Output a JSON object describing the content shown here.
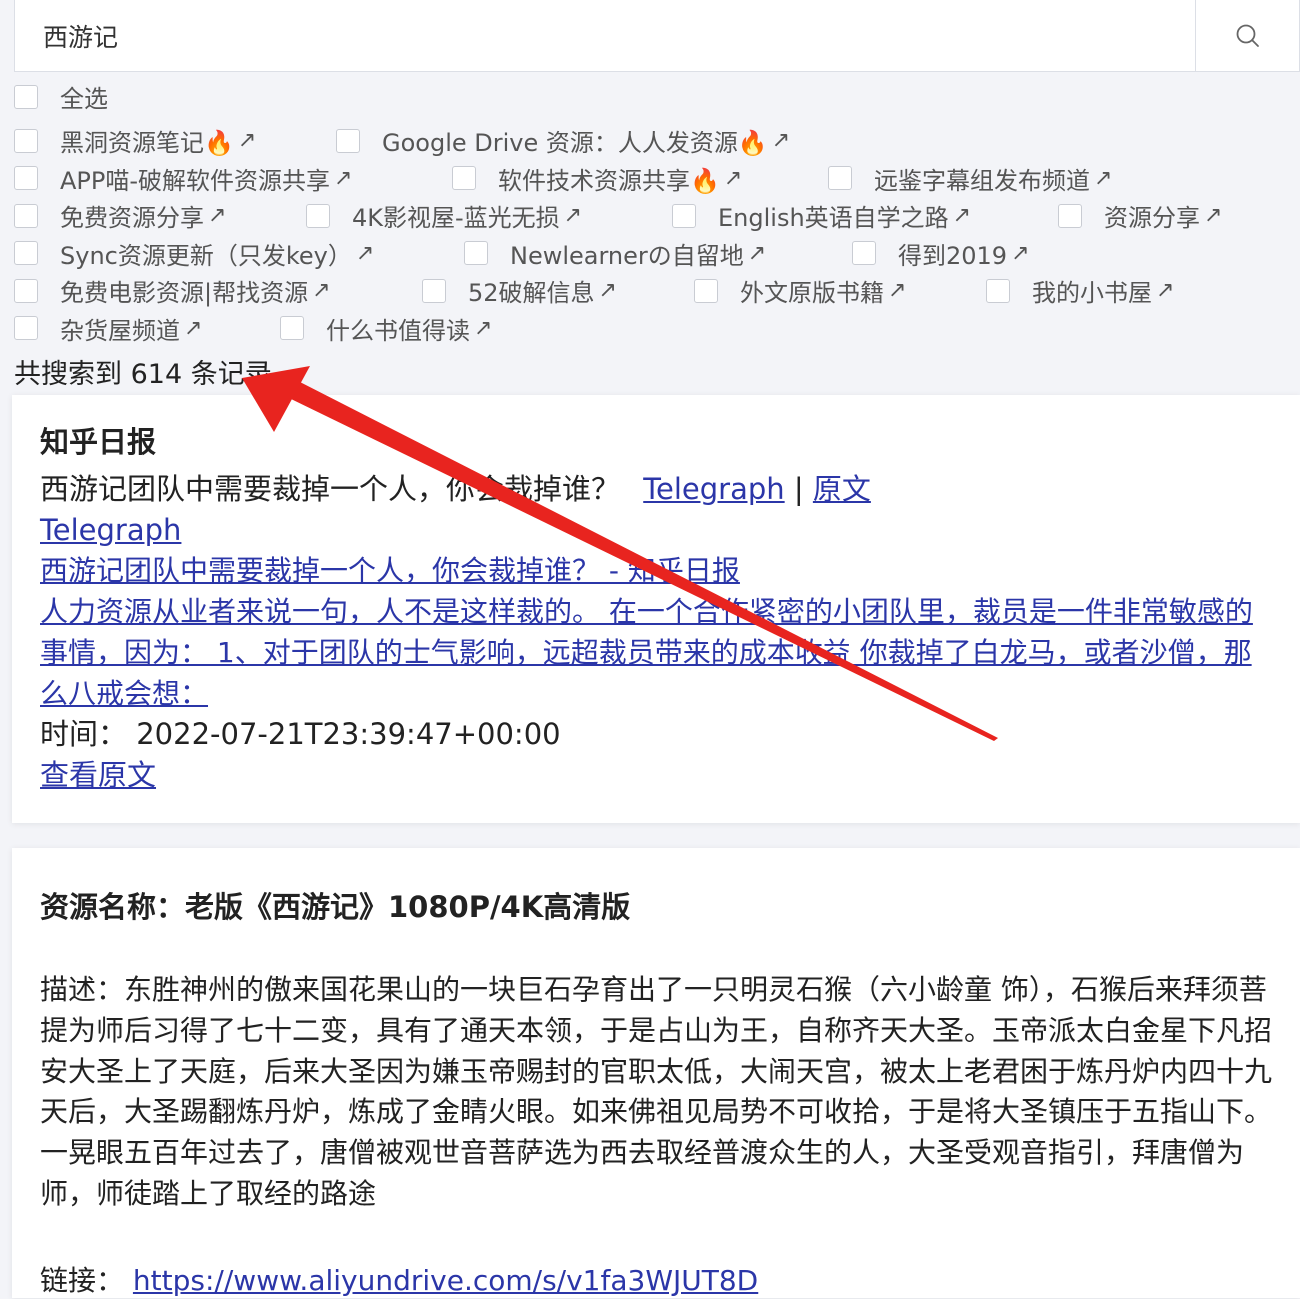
{
  "search": {
    "value": "西游记"
  },
  "select_all_label": "全选",
  "ext_symbol": "↗",
  "channels": [
    [
      {
        "label": "黑洞资源笔记🔥"
      },
      {
        "label": "Google Drive 资源：人人发资源🔥"
      }
    ],
    [
      {
        "label": "APP喵-破解软件资源共享"
      },
      {
        "label": "软件技术资源共享🔥"
      },
      {
        "label": "远鉴字幕组发布频道"
      }
    ],
    [
      {
        "label": "免费资源分享"
      },
      {
        "label": "4K影视屋-蓝光无损"
      },
      {
        "label": "English英语自学之路"
      },
      {
        "label": "资源分享"
      }
    ],
    [
      {
        "label": "Sync资源更新（只发key）"
      },
      {
        "label": "Newlearnerの自留地"
      },
      {
        "label": "得到2019"
      }
    ],
    [
      {
        "label": "免费电影资源|帮找资源"
      },
      {
        "label": "52破解信息"
      },
      {
        "label": "外文原版书籍"
      },
      {
        "label": "我的小书屋"
      }
    ],
    [
      {
        "label": "杂货屋频道"
      },
      {
        "label": "什么书值得读"
      }
    ]
  ],
  "result_count": "共搜索到 614 条记录",
  "result1": {
    "source": "知乎日报",
    "question": "西游记团队中需要裁掉一个人，你会裁掉谁？",
    "link_telegraph": "Telegraph",
    "separator": "|",
    "link_original": "原文",
    "telegraph_heading": "Telegraph",
    "article_title": "西游记团队中需要裁掉一个人，你会裁掉谁？ - 知乎日报",
    "article_desc": "人力资源从业者来说一句，人不是这样裁的。 在一个合作紧密的小团队里，裁员是一件非常敏感的事情，因为： 1、对于团队的士气影响，远超裁员带来的成本收益 你裁掉了白龙马，或者沙僧，那么八戒会想：",
    "time_label": "时间：",
    "time_value": "2022-07-21T23:39:47+00:00",
    "view_original": "查看原文"
  },
  "result2": {
    "title": "资源名称：老版《西游记》1080P/4K高清版",
    "description": "描述：东胜神州的傲来国花果山的一块巨石孕育出了一只明灵石猴（六小龄童 饰），石猴后来拜须菩提为师后习得了七十二变，具有了通天本领，于是占山为王，自称齐天大圣。玉帝派太白金星下凡招安大圣上了天庭，后来大圣因为嫌玉帝赐封的官职太低，大闹天宫，被太上老君困于炼丹炉内四十九天后，大圣踢翻炼丹炉，炼成了金睛火眼。如来佛祖见局势不可收拾，于是将大圣镇压于五指山下。一晃眼五百年过去了，唐僧被观世音菩萨选为西去取经普渡众生的人，大圣受观音指引，拜唐僧为师，师徒踏上了取经的路途",
    "link_label": "链接：",
    "link_url": "https://www.aliyundrive.com/s/v1fa3WJUT8D"
  },
  "colors": {
    "link": "#2b36a8",
    "arrow": "#e8241f",
    "background": "#f3f4f8"
  }
}
